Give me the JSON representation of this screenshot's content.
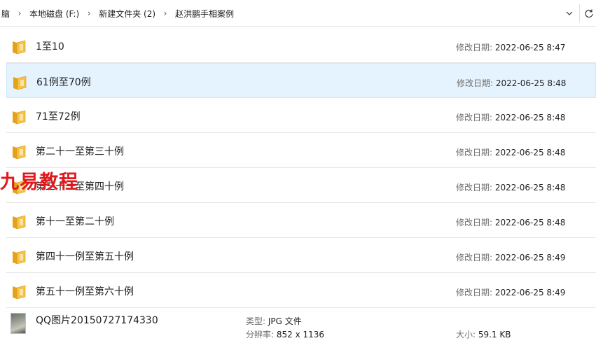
{
  "breadcrumb": {
    "items": [
      "脑",
      "本地磁盘 (F:)",
      "新建文件夹 (2)",
      "赵洪鹏手相案例"
    ]
  },
  "folders": [
    {
      "name": "1至10",
      "date_label": "修改日期:",
      "date": "2022-06-25 8:47",
      "selected": false
    },
    {
      "name": "61例至70例",
      "date_label": "修改日期:",
      "date": "2022-06-25 8:48",
      "selected": true
    },
    {
      "name": "71至72例",
      "date_label": "修改日期:",
      "date": "2022-06-25 8:48",
      "selected": false
    },
    {
      "name": "第二十一至第三十例",
      "date_label": "修改日期:",
      "date": "2022-06-25 8:48",
      "selected": false
    },
    {
      "name": "第三十一至第四十例",
      "date_label": "修改日期:",
      "date": "2022-06-25 8:48",
      "selected": false
    },
    {
      "name": "第十一至第二十例",
      "date_label": "修改日期:",
      "date": "2022-06-25 8:48",
      "selected": false
    },
    {
      "name": "第四十一例至第五十例",
      "date_label": "修改日期:",
      "date": "2022-06-25 8:49",
      "selected": false
    },
    {
      "name": "第五十一例至第六十例",
      "date_label": "修改日期:",
      "date": "2022-06-25 8:49",
      "selected": false
    }
  ],
  "file": {
    "name": "QQ图片20150727174330",
    "type_label": "类型:",
    "type": "JPG 文件",
    "res_label": "分辨率:",
    "resolution": "852 x 1136",
    "size_label": "大小:",
    "size": "59.1 KB"
  },
  "watermark": "九易教程",
  "colors": {
    "selected_bg": "#e5f3ff",
    "selected_border": "#cce8ff",
    "folder_yellow": "#f5c242",
    "watermark_red": "#e0191d"
  }
}
